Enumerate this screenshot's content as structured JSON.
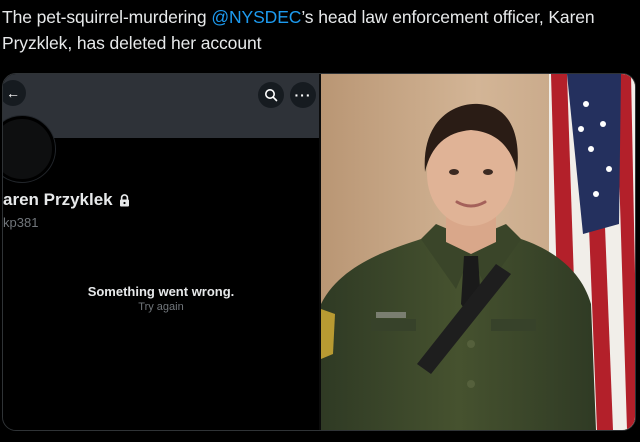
{
  "tweet": {
    "text_before": "The pet-squirrel-murdering ",
    "mention": "@NYSDEC",
    "text_after": "’s head law enforcement officer, Karen Pryzklek, has deleted her account"
  },
  "profile": {
    "name": "aren Przyklek",
    "handle": "kp381",
    "error_title": "Something went wrong.",
    "error_retry": "Try again"
  },
  "icons": {
    "back": "back-arrow-icon",
    "search": "search-icon",
    "more": "more-icon",
    "lock": "lock-icon"
  },
  "colors": {
    "mention": "#1d9bf0",
    "uniform": "#3e4a30",
    "wall": "#c9aa8a"
  }
}
